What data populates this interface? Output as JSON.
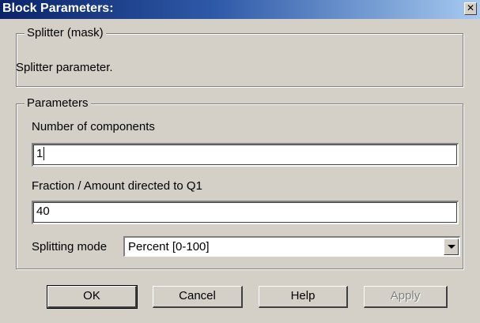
{
  "window": {
    "title": "Block Parameters:",
    "close_symbol": "✕"
  },
  "mask_group": {
    "label": "Splitter (mask)",
    "description": "Splitter parameter."
  },
  "parameters_group": {
    "label": "Parameters",
    "components": {
      "label": "Number of components",
      "value": "1"
    },
    "fraction": {
      "label": "Fraction / Amount directed to Q1",
      "value": "40"
    },
    "mode": {
      "label": "Splitting mode",
      "selected": "Percent [0-100]"
    }
  },
  "buttons": {
    "ok": "OK",
    "cancel": "Cancel",
    "help": "Help",
    "apply": "Apply"
  },
  "colors": {
    "titlebar_start": "#0a246a",
    "titlebar_end": "#a6caf0",
    "face": "#d4d0c8"
  }
}
